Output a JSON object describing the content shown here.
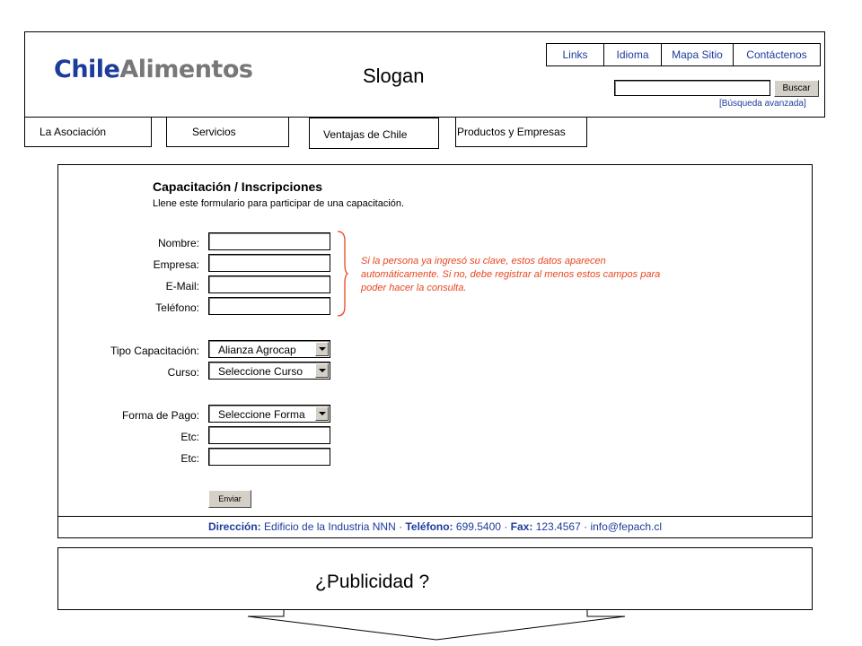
{
  "header": {
    "logo": {
      "part1": "Chile",
      "part2": "Alimentos"
    },
    "slogan": "Slogan",
    "top_links": [
      "Links",
      "Idioma",
      "Mapa Sitio",
      "Contáctenos"
    ],
    "search": {
      "value": "",
      "button_label": "Buscar",
      "advanced_link": "[Búsqueda avanzada]"
    }
  },
  "nav": {
    "tabs": [
      "La Asociación",
      "Servicios",
      "Ventajas de Chile",
      "Productos y Empresas"
    ]
  },
  "form": {
    "title": "Capacitación / Inscripciones",
    "description": "Llene este formulario para participar de una capacitación.",
    "fields": {
      "nombre": {
        "label": "Nombre:",
        "value": ""
      },
      "empresa": {
        "label": "Empresa:",
        "value": ""
      },
      "email": {
        "label": "E-Mail:",
        "value": ""
      },
      "telefono": {
        "label": "Teléfono:",
        "value": ""
      },
      "tipo_capacitacion": {
        "label": "Tipo Capacitación:",
        "selected": "Alianza Agrocap"
      },
      "curso": {
        "label": "Curso:",
        "selected": "Seleccione Curso"
      },
      "forma_pago": {
        "label": "Forma de Pago:",
        "selected": "Seleccione Forma"
      },
      "etc1": {
        "label": "Etc:",
        "value": ""
      },
      "etc2": {
        "label": "Etc:",
        "value": ""
      }
    },
    "note": "Si la persona ya ingresó su clave, estos datos aparecen automáticamente. Si no, debe registrar al menos estos campos para poder hacer la consulta.",
    "submit_label": "Enviar"
  },
  "footer": {
    "address_label": "Dirección:",
    "address": "Edificio de la Industria NNN",
    "phone_label": "Teléfono:",
    "phone": "699.5400",
    "fax_label": "Fax:",
    "fax": "123.4567",
    "email": "info@fepach.cl",
    "separator": "·"
  },
  "ad": {
    "text": "¿Publicidad ?"
  },
  "colors": {
    "brand_blue": "#1c3c9c",
    "logo_gray": "#777777",
    "note_orange": "#e8461e",
    "button_face": "#d4d0c8"
  }
}
